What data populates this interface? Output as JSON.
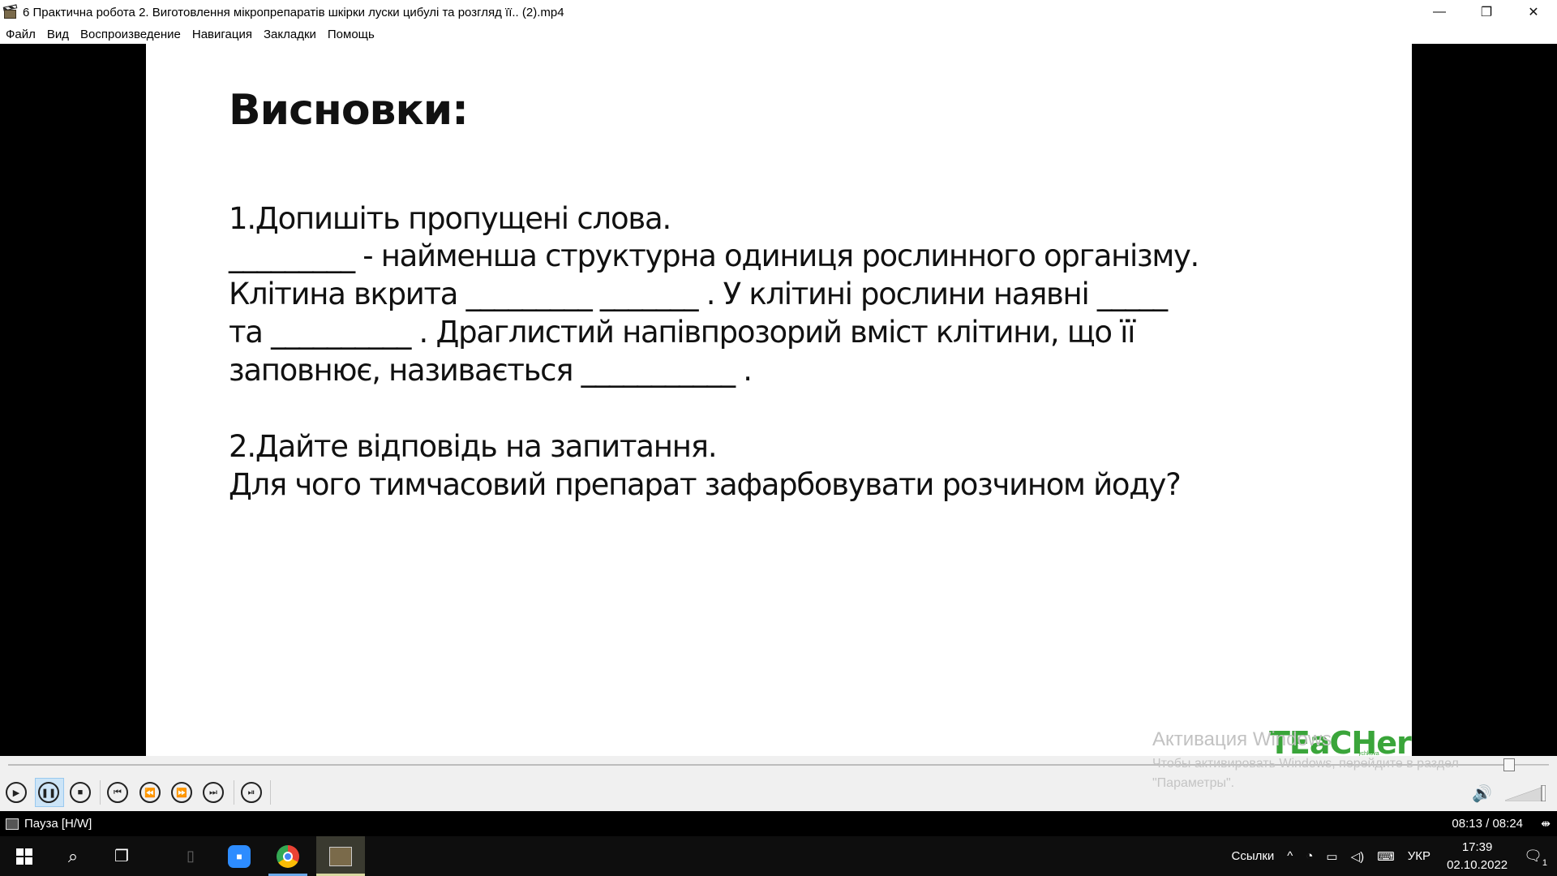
{
  "window": {
    "title": "6  Практична робота 2. Виготовлення мікропрепаратів шкірки луски цибулі та розгляд її.. (2).mp4",
    "minimize_glyph": "—",
    "maximize_glyph": "❐",
    "close_glyph": "✕"
  },
  "menu": {
    "items": [
      "Файл",
      "Вид",
      "Воспроизведение",
      "Навигация",
      "Закладки",
      "Помощь"
    ]
  },
  "slide": {
    "heading": "Висновки:",
    "task1_title": "1.Допишіть пропущені слова.",
    "lines": [
      "_________ - найменша структурна одиниця рослинного організму.",
      "Клітина вкрита _________ _______ . У клітині рослини наявні _____",
      "та __________ . Драглистий напівпрозорий вміст клітини, що її",
      "заповнює, називається ___________ ."
    ],
    "task2_title": "2.Дайте відповідь на запитання.",
    "task2_question": "Для чого тимчасовий препарат зафарбовувати розчином йоду?",
    "logo_main": "TEaCHer",
    "logo_sub": "ychkova"
  },
  "player": {
    "seek_progress": 0.974,
    "volume_level": 1.0,
    "status": "Пауза [H/W]",
    "time": "08:13 / 08:24",
    "controls": {
      "play": "▶",
      "pause": "❚❚",
      "stop": "■",
      "prev": "⏮",
      "rewind": "⏪",
      "forward": "⏩",
      "next": "⏭",
      "frame_step": "⏯"
    }
  },
  "activation": {
    "title": "Активация Windows",
    "text": "Чтобы активировать Windows, перейдите в раздел \"Параметры\"."
  },
  "taskbar": {
    "tray_links": "Ссылки",
    "lang": "УКР",
    "time": "17:39",
    "date": "02.10.2022",
    "notification_count": "1"
  },
  "colors": {
    "accent_blue": "#1b8fc9",
    "logo_green": "#3aa53a",
    "active_button": "#cce4f7"
  }
}
